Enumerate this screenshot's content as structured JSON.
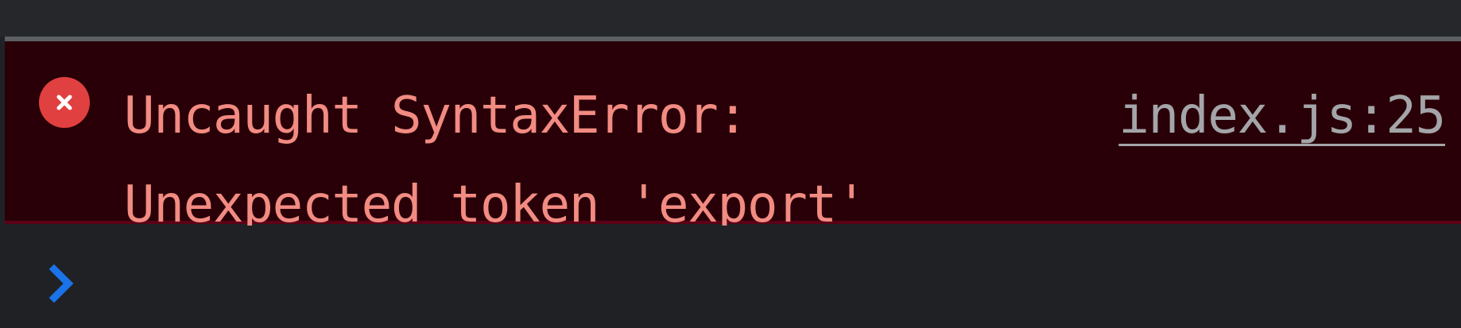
{
  "console": {
    "message": {
      "level": "error",
      "icon": "error-circle-x-icon",
      "text": "Uncaught SyntaxError:\nUnexpected token 'export'",
      "source": "index.js:25",
      "text_color": "#f28b82",
      "background_color": "#290008"
    },
    "prompt": {
      "icon": "chevron-right-icon",
      "icon_color": "#1a73e8"
    }
  }
}
